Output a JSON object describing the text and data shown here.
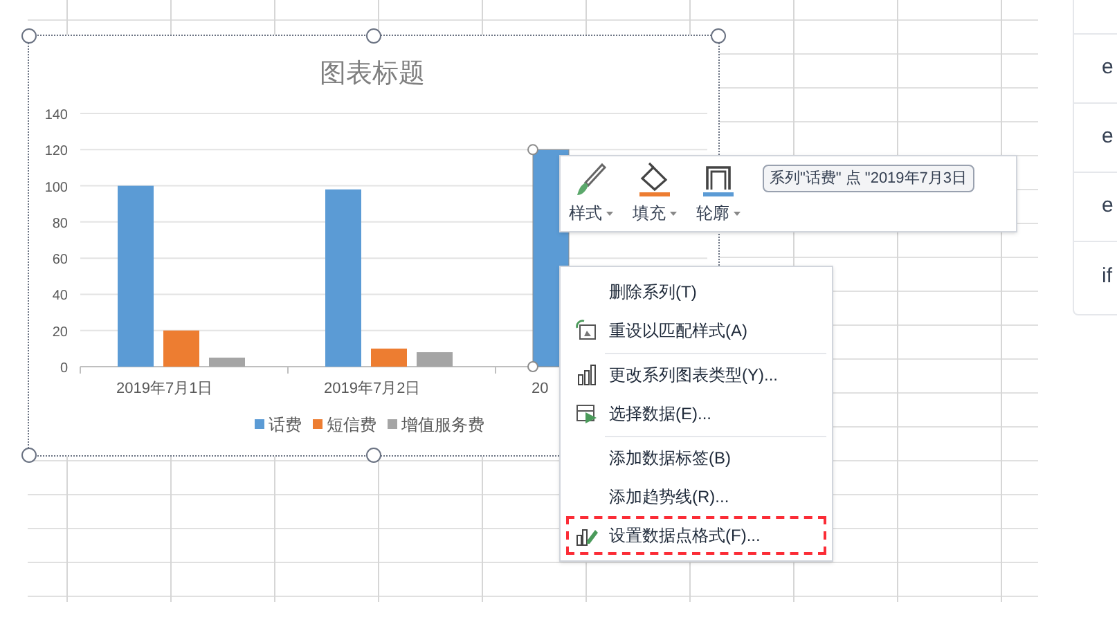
{
  "chart": {
    "chart_data": {
      "type": "bar",
      "title": "图表标题",
      "categories": [
        "2019年7月1日",
        "2019年7月2日",
        "20"
      ],
      "series": [
        {
          "name": "话费",
          "color": "#5b9bd5",
          "values": [
            100,
            98,
            120
          ]
        },
        {
          "name": "短信费",
          "color": "#ed7d31",
          "values": [
            20,
            10,
            null
          ]
        },
        {
          "name": "增值服务费",
          "color": "#a5a5a5",
          "values": [
            5,
            8,
            null
          ]
        }
      ],
      "ylim": [
        0,
        140
      ],
      "yticks": [
        0,
        20,
        40,
        60,
        80,
        100,
        120,
        140
      ],
      "grid": true,
      "legend": true
    },
    "selected_points": [
      false,
      false,
      true
    ]
  },
  "format_toolbar": {
    "buttons": [
      {
        "kind": "style",
        "label": "样式"
      },
      {
        "kind": "fill",
        "label": "填充"
      },
      {
        "kind": "outline",
        "label": "轮廓"
      }
    ],
    "element_dropdown": "系列\"话费\" 点 \"2019年7月3日"
  },
  "context_menu": {
    "items": [
      {
        "kind": "plain",
        "label": "删除系列(T)",
        "separator_before": false,
        "selected": false
      },
      {
        "kind": "reset",
        "label": "重设以匹配样式(A)",
        "separator_before": false,
        "selected": false
      },
      {
        "kind": "chart-type",
        "label": "更改系列图表类型(Y)...",
        "separator_before": true,
        "selected": false
      },
      {
        "kind": "select-data",
        "label": "选择数据(E)...",
        "separator_before": false,
        "selected": false
      },
      {
        "kind": "plain",
        "label": "添加数据标签(B)",
        "separator_before": true,
        "selected": false
      },
      {
        "kind": "plain",
        "label": "添加趋势线(R)...",
        "separator_before": false,
        "selected": false
      },
      {
        "kind": "format-point",
        "label": "设置数据点格式(F)...",
        "separator_before": false,
        "selected": true
      }
    ]
  },
  "side_list": {
    "items": [
      "e",
      "e",
      "e",
      "if"
    ]
  }
}
